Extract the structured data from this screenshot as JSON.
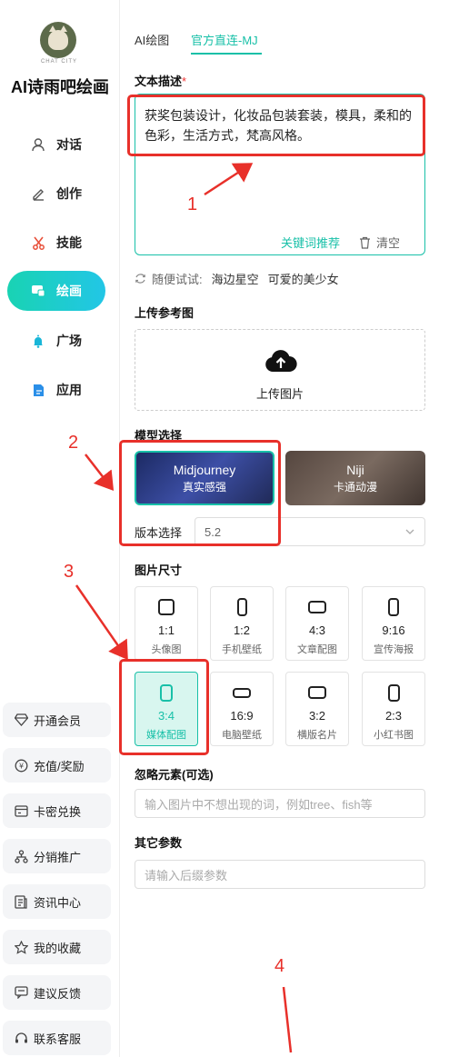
{
  "app": {
    "title": "AI诗雨吧绘画",
    "logo_text": "CHAT CITY"
  },
  "nav": [
    {
      "label": "对话",
      "icon": "user-icon"
    },
    {
      "label": "创作",
      "icon": "pen-icon"
    },
    {
      "label": "技能",
      "icon": "scissors-icon"
    },
    {
      "label": "绘画",
      "icon": "paint-icon",
      "active": true
    },
    {
      "label": "广场",
      "icon": "bell-icon"
    },
    {
      "label": "应用",
      "icon": "app-icon"
    }
  ],
  "side_buttons": [
    {
      "label": "开通会员",
      "icon": "diamond-icon"
    },
    {
      "label": "充值/奖励",
      "icon": "coin-icon"
    },
    {
      "label": "卡密兑换",
      "icon": "card-icon"
    },
    {
      "label": "分销推广",
      "icon": "network-icon"
    },
    {
      "label": "资讯中心",
      "icon": "news-icon"
    },
    {
      "label": "我的收藏",
      "icon": "star-icon"
    },
    {
      "label": "建议反馈",
      "icon": "feedback-icon"
    },
    {
      "label": "联系客服",
      "icon": "headset-icon"
    }
  ],
  "tabs": {
    "ai": "AI绘图",
    "mj": "官方直连-MJ"
  },
  "prompt": {
    "label": "文本描述",
    "required_mark": "*",
    "value": "获奖包装设计，化妆品包装套装，模具，柔和的色彩，生活方式，梵高风格。",
    "keyword_link": "关键词推荐",
    "clear_label": "清空"
  },
  "random": {
    "label": "随便试试:",
    "chips": [
      "海边星空",
      "可爱的美少女"
    ]
  },
  "upload": {
    "label": "上传参考图",
    "button": "上传图片"
  },
  "model": {
    "label": "模型选择",
    "cards": [
      {
        "name": "Midjourney",
        "sub": "真实感强"
      },
      {
        "name": "Niji",
        "sub": "卡通动漫"
      }
    ],
    "version_label": "版本选择",
    "version_value": "5.2"
  },
  "sizes": {
    "label": "图片尺寸",
    "items": [
      {
        "ratio": "1:1",
        "usage": "头像图"
      },
      {
        "ratio": "1:2",
        "usage": "手机壁纸"
      },
      {
        "ratio": "4:3",
        "usage": "文章配图"
      },
      {
        "ratio": "9:16",
        "usage": "宣传海报"
      },
      {
        "ratio": "3:4",
        "usage": "媒体配图",
        "active": true
      },
      {
        "ratio": "16:9",
        "usage": "电脑壁纸"
      },
      {
        "ratio": "3:2",
        "usage": "横版名片"
      },
      {
        "ratio": "2:3",
        "usage": "小红书图"
      }
    ]
  },
  "ignore": {
    "label": "忽略元素(可选)",
    "placeholder": "输入图片中不想出现的词，例如tree、fish等"
  },
  "other": {
    "label": "其它参数",
    "placeholder": "请输入后缀参数"
  },
  "annotations": [
    "1",
    "2",
    "3",
    "4"
  ],
  "colors": {
    "accent": "#18c0a8",
    "annotation": "#e8302a"
  }
}
